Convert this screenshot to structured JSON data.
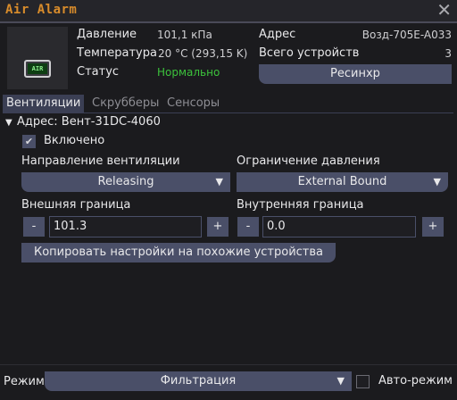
{
  "window": {
    "title": "Air Alarm",
    "close_glyph": "✕"
  },
  "device": {
    "icon": "air-alarm-icon",
    "icon_text": "AIR"
  },
  "status": {
    "pressure_label": "Давление",
    "pressure_value": "101,1 кПа",
    "temperature_label": "Температура",
    "temperature_value": "20 °C (293,15 K)",
    "status_label": "Статус",
    "status_value": "Нормально",
    "address_label": "Адрес",
    "address_value": "Возд-705E-A033",
    "devices_label": "Всего устройств",
    "devices_value": "3",
    "resync_label": "Ресинхр"
  },
  "tabs": [
    {
      "label": "Вентиляции",
      "active": true
    },
    {
      "label": "Скрубберы",
      "active": false
    },
    {
      "label": "Сенсоры",
      "active": false
    }
  ],
  "vent": {
    "collapse_glyph": "▼",
    "address_text": "Адрес: Вент-31DC-4060",
    "enabled_label": "Включено",
    "enabled_checked": true,
    "direction_label": "Направление вентиляции",
    "direction_value": "Releasing",
    "pressure_limit_label": "Ограничение давления",
    "pressure_limit_value": "External Bound",
    "external_bound_label": "Внешняя граница",
    "external_bound_value": "101.3",
    "internal_bound_label": "Внутренняя граница",
    "internal_bound_value": "0.0",
    "minus_label": "-",
    "plus_label": "+",
    "copy_settings_label": "Копировать настройки на похожие устройства"
  },
  "footer": {
    "mode_label": "Режим",
    "mode_value": "Фильтрация",
    "auto_mode_label": "Авто-режим",
    "auto_mode_checked": false
  },
  "colors": {
    "accent": "#d98c2b",
    "button": "#4a4f68",
    "status_ok": "#3cc23c",
    "background": "#1b1b1e"
  }
}
